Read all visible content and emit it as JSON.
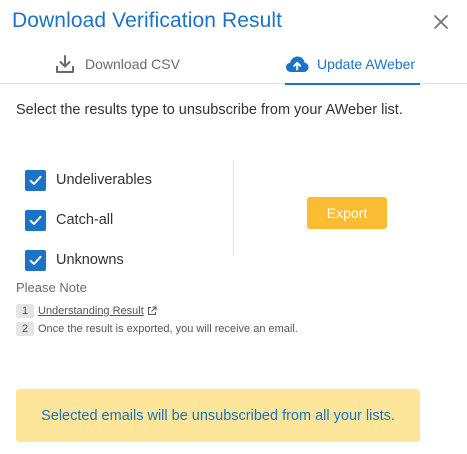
{
  "dialog": {
    "title": "Download Verification Result",
    "close_icon": "close-icon"
  },
  "tabs": [
    {
      "label": "Download CSV",
      "icon": "download-icon",
      "active": false
    },
    {
      "label": "Update AWeber",
      "icon": "cloud-upload-icon",
      "active": true
    }
  ],
  "intro_text": "Select the results type to unsubscribe from your AWeber list.",
  "options": [
    {
      "label": "Undeliverables",
      "checked": true
    },
    {
      "label": "Catch-all",
      "checked": true
    },
    {
      "label": "Unknowns",
      "checked": true
    }
  ],
  "export_label": "Export",
  "note": {
    "title": "Please Note",
    "items": [
      {
        "num": "1",
        "text": "Understanding Result",
        "icon": "external-link-icon"
      },
      {
        "num": "2",
        "text": "Once the result is exported, you will receive an email."
      }
    ]
  },
  "banner_text": "Selected emails will be unsubscribed from all your lists.",
  "colors": {
    "accent": "#1a73c8",
    "export_button": "#fbbc34",
    "banner_bg": "#fde69a"
  }
}
